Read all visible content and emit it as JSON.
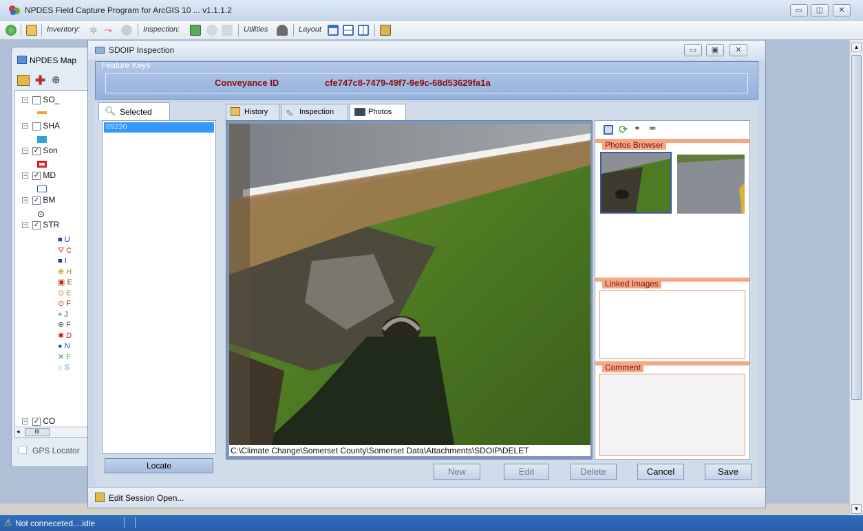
{
  "app": {
    "title": "NPDES Field Capture Program for ArcGIS 10  ... v1.1.1.2"
  },
  "toolbar": {
    "inventory_label": "Inventory:",
    "inspection_label": "Inspection:",
    "utilities_label": "Utilities",
    "layout_label": "Layout"
  },
  "toc": {
    "title": "NPDES Map",
    "layers": [
      {
        "label": "SO_",
        "checked": false
      },
      {
        "label": "SHA",
        "checked": false
      },
      {
        "label": "Son",
        "checked": true
      },
      {
        "label": "MD",
        "checked": true
      },
      {
        "label": "BM",
        "checked": true
      },
      {
        "label": "STR",
        "checked": true
      },
      {
        "label": "CO",
        "checked": true
      }
    ],
    "sublegend": [
      "U",
      "C",
      "I",
      "H",
      "E",
      "E",
      "F",
      "J",
      "F",
      "D",
      "N",
      "F",
      "S"
    ],
    "scroll_thumb": "III",
    "gps_label": "GPS Locator"
  },
  "dialog": {
    "title": "SDOIP Inspection",
    "feature_keys_legend": "Feature Keys",
    "conveyance_label": "Conveyance ID",
    "conveyance_value": "cfe747c8-7479-49f7-9e9c-68d53629fa1a",
    "selected_tab": "Selected",
    "selected_items": [
      "69220"
    ],
    "locate_button": "Locate",
    "tabs": [
      "History",
      "Inspection",
      "Photos"
    ],
    "active_tab": "Photos",
    "photo_path": "C:\\Climate Change\\Somerset County\\Somerset Data\\Attachments\\SDOIP\\DELET",
    "photos_browser_label": "Photos Browser",
    "linked_images_label": "Linked Images",
    "comment_label": "Comment",
    "buttons": {
      "new": "New",
      "edit": "Edit",
      "delete": "Delete",
      "cancel": "Cancel",
      "save": "Save"
    },
    "status": "Edit Session Open..."
  },
  "statusbar": {
    "text": "Not conneceted....idle"
  }
}
